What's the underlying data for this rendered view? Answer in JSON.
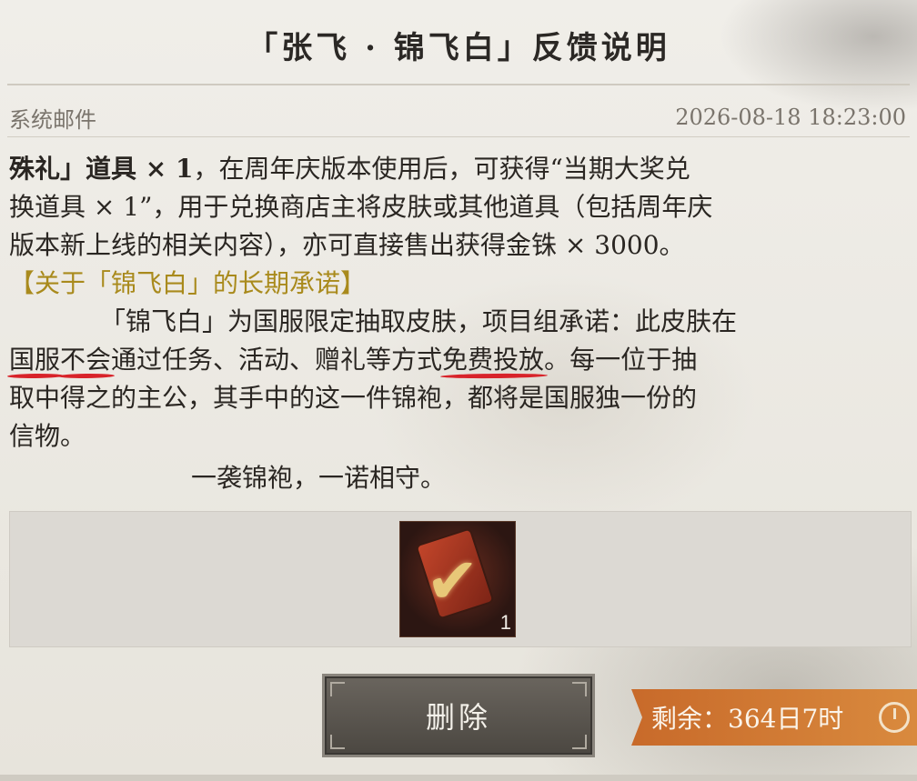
{
  "mail": {
    "title": "「张飞 · 锦飞白」反馈说明",
    "sender": "系统邮件",
    "timestamp": "2026-08-18 18:23:00",
    "para1": {
      "bold": "殊礼」道具 × 1",
      "line1_rest": "，在周年庆版本使用后，可获得“当期大奖兑",
      "line2": "换道具 × 1”，用于兑换商店主将皮肤或其他道具（包括周年庆",
      "line3": "版本新上线的相关内容），亦可直接售出获得金铢 × 3000。"
    },
    "heading": "【关于「锦飞白」的长期承诺】",
    "para2": {
      "line1": "「锦飞白」为国服限定抽取皮肤，项目组承诺：此皮肤在",
      "line2_a": "国服",
      "line2_b": "不会",
      "line2_c": "通过任务、活动、赠礼等方式",
      "line2_d": "免费投放",
      "line2_e": "。每一位于抽",
      "line3": "取中得之的主公，其手中的这一件锦袍，都将是国服独一份的",
      "line4": "信物。"
    },
    "closing": "一袭锦袍，一诺相守。"
  },
  "reward": {
    "count": "1",
    "icon": "red-card-check-icon"
  },
  "actions": {
    "delete_label": "删除",
    "remaining": "剩余：364日7时"
  },
  "colors": {
    "heading": "#a98a1c",
    "underline": "#d8232a",
    "remaining_bg": "#c86a2a"
  }
}
